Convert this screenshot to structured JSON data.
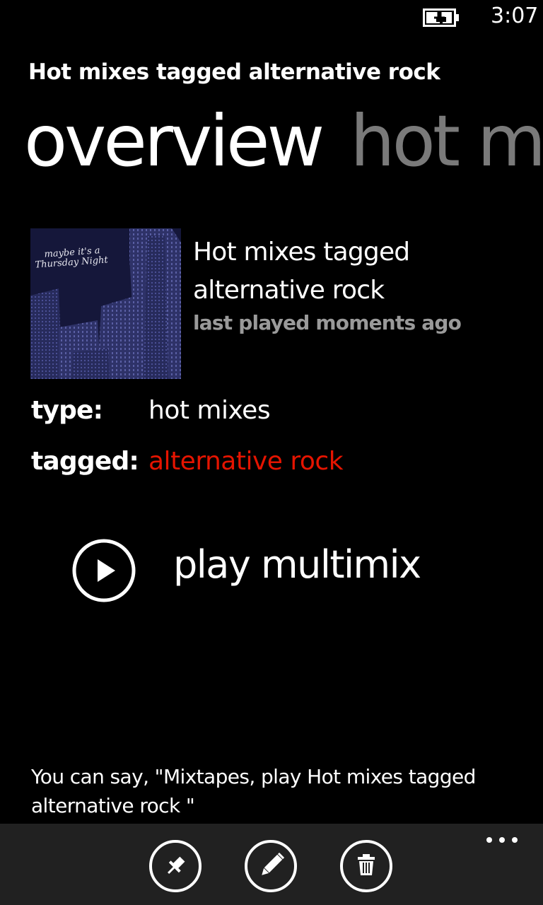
{
  "status_bar": {
    "battery_icon": "battery-charging-icon",
    "time": "3:07"
  },
  "app_title": "Hot mixes tagged alternative rock",
  "pivot": {
    "active_tab": "overview",
    "next_tab": "hot m"
  },
  "album": {
    "art_caption_line1": "maybe it's a",
    "art_caption_line2": "Thursday Night",
    "title": "Hot mixes tagged alternative rock",
    "last_played": "last played moments ago"
  },
  "details": {
    "type_label": "type:",
    "type_value": "hot mixes",
    "tagged_label": "tagged:",
    "tagged_value": "alternative rock"
  },
  "play": {
    "icon": "play-circle-icon",
    "label": "play multimix"
  },
  "voice_hint": "You can say, \"Mixtapes, play Hot mixes tagged alternative rock \"",
  "app_bar": {
    "buttons": [
      {
        "icon": "pin-icon"
      },
      {
        "icon": "edit-icon"
      },
      {
        "icon": "delete-icon"
      }
    ],
    "more_icon": "ellipsis-icon"
  },
  "colors": {
    "background": "#000000",
    "accent": "#e51400",
    "secondary_text": "#9a9a9a",
    "pivot_inactive": "#7a7a7a",
    "app_bar": "#212121"
  }
}
